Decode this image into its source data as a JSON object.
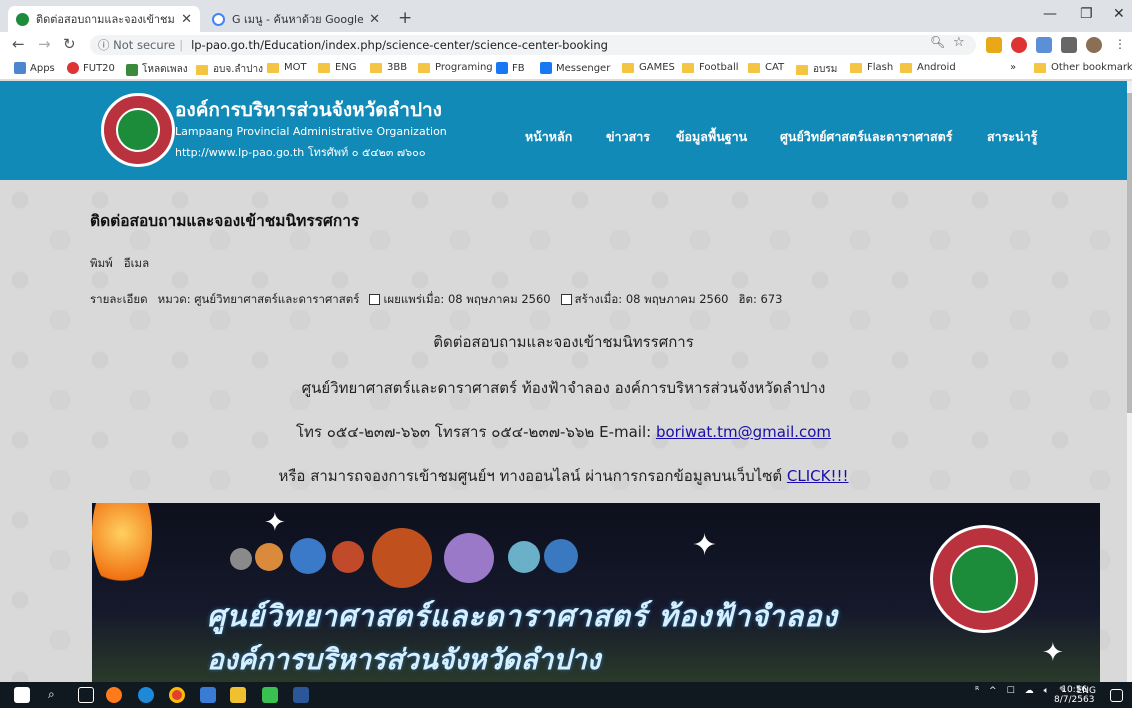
{
  "browser": {
    "tabs": [
      {
        "title": "ติดต่อสอบถามและจองเข้าชมนิทรรศการ",
        "favicon_color": "#1c8b3a"
      },
      {
        "title": "G เมนู - ค้นหาด้วย Google",
        "favicon_color": "#4285f4"
      }
    ],
    "security": "ⓘ Not secure",
    "url": "lp-pao.go.th/Education/index.php/science-center/science-center-booking",
    "bookmarks": [
      "Apps",
      "FUT20",
      "โหลดเพลง",
      "อบจ.ลำปาง",
      "MOT",
      "ENG",
      "3BB",
      "Programing",
      "FB",
      "Messenger",
      "GAMES",
      "Football",
      "CAT",
      "อบรม",
      "Flash",
      "Android",
      "»",
      "Other bookmarks"
    ]
  },
  "site": {
    "org_th": "องค์การบริหารส่วนจังหวัดลำปาง",
    "org_en": "Lampaang Provincial Administrative Organization",
    "org_web": "http://www.lp-pao.go.th โทรศัพท์ ๐ ๕๔๒๓ ๗๖๐๐",
    "nav": [
      "หน้าหลัก",
      "ข่าวสาร",
      "ข้อมูลพื้นฐาน",
      "ศูนย์วิทย์ศาสตร์และดาราศาสตร์",
      "สาระน่ารู้"
    ]
  },
  "article": {
    "title": "ติดต่อสอบถามและจองเข้าชมนิทรรศการ",
    "print": "พิมพ์",
    "email": "อีเมล",
    "details": "รายละเอียด",
    "category": "หมวด: ศูนย์วิทยาศาสตร์และดาราศาสตร์",
    "published": "เผยแพร่เมื่อ: 08 พฤษภาคม 2560",
    "created": "สร้างเมื่อ: 08 พฤษภาคม 2560",
    "hits": "ฮิต: 673",
    "line1": "ติดต่อสอบถามและจองเข้าชมนิทรรศการ",
    "line2": "ศูนย์วิทยาศาสตร์และดาราศาสตร์ ท้องฟ้าจำลอง องค์การบริหารส่วนจังหวัดลำปาง",
    "line3_text": "โทร ๐๕๔-๒๓๗-๖๖๓ โทรสาร ๐๕๔-๒๓๗-๖๖๒ E-mail: ",
    "line3_email": "boriwat.tm@gmail.com",
    "line4_text": "หรือ สามารถจองการเข้าชมศูนย์ฯ ทางออนไลน์ ผ่านการกรอกข้อมูลบนเว็บไซต์ ",
    "line4_link": "CLICK!!!",
    "banner_line1": "ศูนย์วิทยาศาสตร์และดาราศาสตร์ ท้องฟ้าจำลอง",
    "banner_line2": "องค์การบริหารส่วนจังหวัดลำปาง"
  },
  "taskbar": {
    "lang": "ENG",
    "time": "10:56",
    "date": "8/7/2563"
  }
}
